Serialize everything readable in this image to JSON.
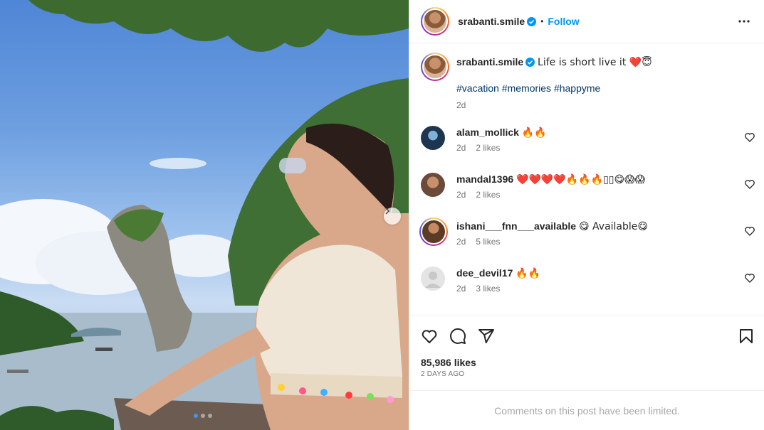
{
  "post": {
    "username": "srabanti.smile",
    "follow_label": "Follow",
    "separator": "•",
    "caption_text": "Life is short live it ❤️😇",
    "hashtags": "#vacation #memories #happyme",
    "caption_age": "2d",
    "likes": "85,986 likes",
    "posted_ago": "2 DAYS AGO",
    "comments_limited": "Comments on this post have been limited."
  },
  "comments": [
    {
      "username": "alam_mollick",
      "text": "🔥🔥",
      "age": "2d",
      "likes": "2 likes"
    },
    {
      "username": "mandal1396",
      "text": "❤️❤️❤️❤️🔥🔥🔥▯▯😋😱😱",
      "age": "2d",
      "likes": "2 likes"
    },
    {
      "username": "ishani___fnn___available",
      "text": "😋 Available😋",
      "age": "2d",
      "likes": "5 likes"
    },
    {
      "username": "dee_devil17",
      "text": "🔥🔥",
      "age": "2d",
      "likes": "3 likes"
    }
  ],
  "carousel": {
    "slides": 3,
    "active_slide": 1
  },
  "colors": {
    "link": "#0095f6",
    "hashtag": "#00376b",
    "muted": "#737373",
    "heart_red": "#e0245e",
    "fire": "#f58220"
  },
  "icons": {
    "verified": "verified-badge-icon",
    "more": "more-options-icon",
    "like": "heart-icon",
    "comment": "comment-icon",
    "share": "share-icon",
    "save": "bookmark-icon",
    "carousel_next": "chevron-right-icon"
  }
}
